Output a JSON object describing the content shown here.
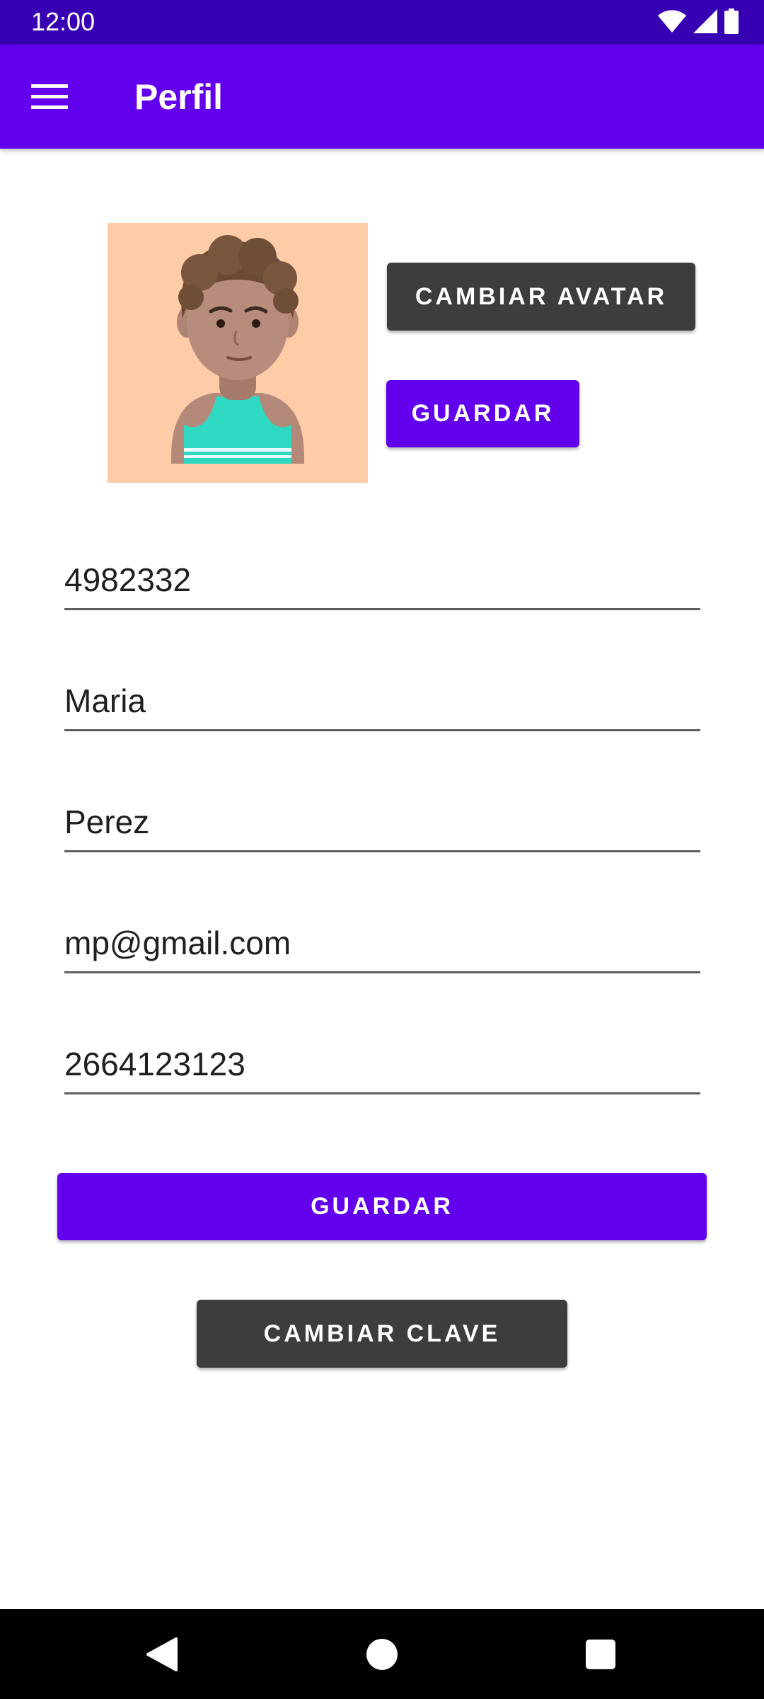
{
  "status_bar": {
    "time": "12:00",
    "icons": [
      "wifi-icon",
      "cell-signal-icon",
      "battery-icon"
    ]
  },
  "app_bar": {
    "title": "Perfil",
    "menu_icon": "hamburger-menu-icon"
  },
  "avatar": {
    "icon": "avatar-image",
    "background": "#ffcca8"
  },
  "buttons": {
    "change_avatar": "CAMBIAR AVATAR",
    "save_avatar": "GUARDAR",
    "save": "GUARDAR",
    "change_password": "CAMBIAR CLAVE"
  },
  "form": {
    "dni": "4982332",
    "first_name": "Maria",
    "last_name": "Perez",
    "email": "mp@gmail.com",
    "phone": "2664123123"
  },
  "nav_bar": {
    "icons": [
      "back-icon",
      "home-icon",
      "recents-icon"
    ]
  },
  "colors": {
    "status_bar": "#3700b3",
    "primary": "#6200ee",
    "dark_button": "#3d3d3d",
    "underline": "#5f5f5f"
  }
}
